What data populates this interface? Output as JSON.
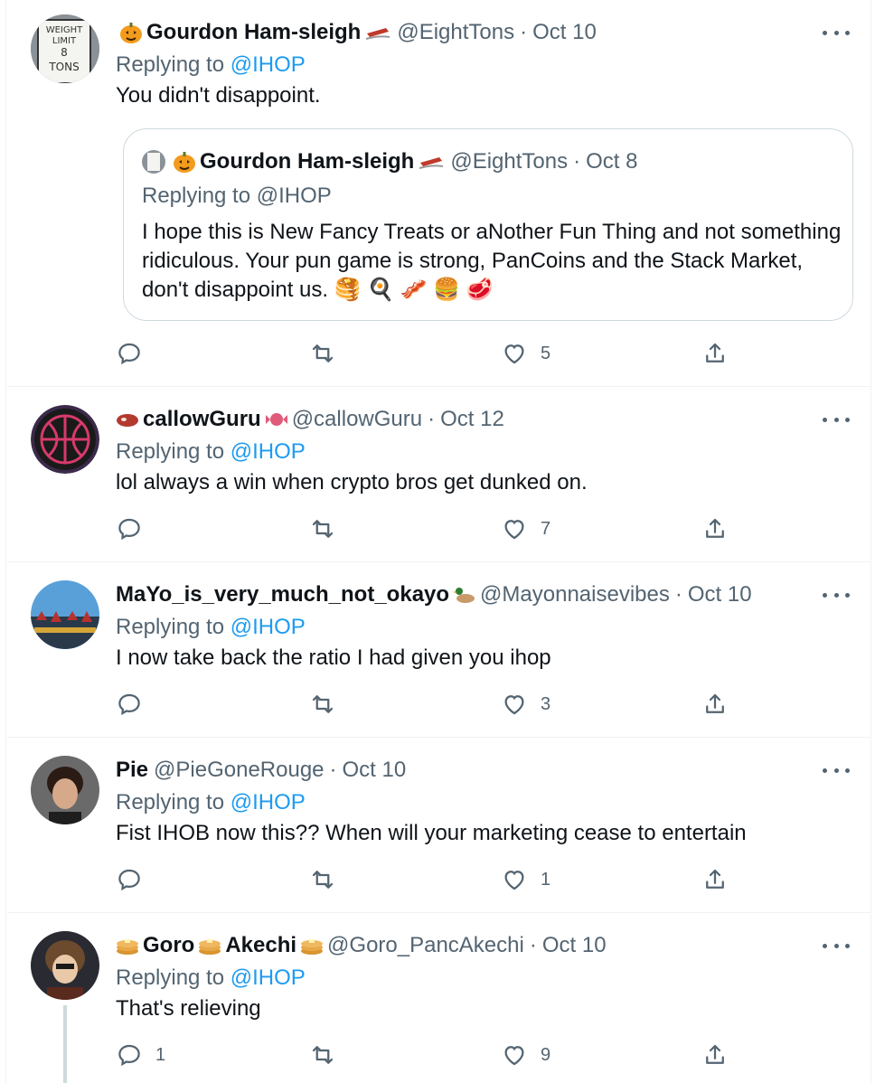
{
  "replying_label": "Replying to",
  "tweets": [
    {
      "name": "Gourdon Ham-sleigh",
      "handle": "@EightTons",
      "date": "Oct 10",
      "replying_to": "@IHOP",
      "text": "You didn't disappoint.",
      "quote": {
        "name": "Gourdon Ham-sleigh",
        "handle": "@EightTons",
        "date": "Oct 8",
        "replying": "Replying to @IHOP",
        "text": "I hope this is New Fancy Treats or aNother Fun Thing and not something ridiculous. Your pun game is strong, PanCoins and the Stack Market, don't disappoint us. 🥞 🍳 🥓 🍔 🥩"
      },
      "replies": "",
      "retweets": "",
      "likes": "5"
    },
    {
      "name": "callowGuru",
      "handle": "@callowGuru",
      "date": "Oct 12",
      "replying_to": "@IHOP",
      "text": "lol always a win when crypto bros get dunked on.",
      "replies": "",
      "retweets": "",
      "likes": "7"
    },
    {
      "name": "MaYo_is_very_much_not_okayo",
      "handle": "@Mayonnaisevibes",
      "date": "Oct 10",
      "replying_to": "@IHOP",
      "text": "I now take back the ratio I had given you ihop",
      "replies": "",
      "retweets": "",
      "likes": "3"
    },
    {
      "name": "Pie",
      "handle": "@PieGoneRouge",
      "date": "Oct 10",
      "replying_to": "@IHOP",
      "text": "Fist IHOB now this?? When will your marketing cease to entertain",
      "replies": "",
      "retweets": "",
      "likes": "1"
    },
    {
      "name_part1": "Goro",
      "name_part2": "Akechi",
      "handle": "@Goro_PancAkechi",
      "date": "Oct 10",
      "replying_to": "@IHOP",
      "text": "That's relieving",
      "replies": "1",
      "retweets": "",
      "likes": "9"
    }
  ],
  "icons": {
    "reply": "reply-icon",
    "retweet": "retweet-icon",
    "like": "heart-icon",
    "share": "share-icon",
    "more": "more-icon"
  },
  "colors": {
    "link": "#1d9bf0",
    "secondary_text": "#536471",
    "border": "#eff3f4"
  }
}
